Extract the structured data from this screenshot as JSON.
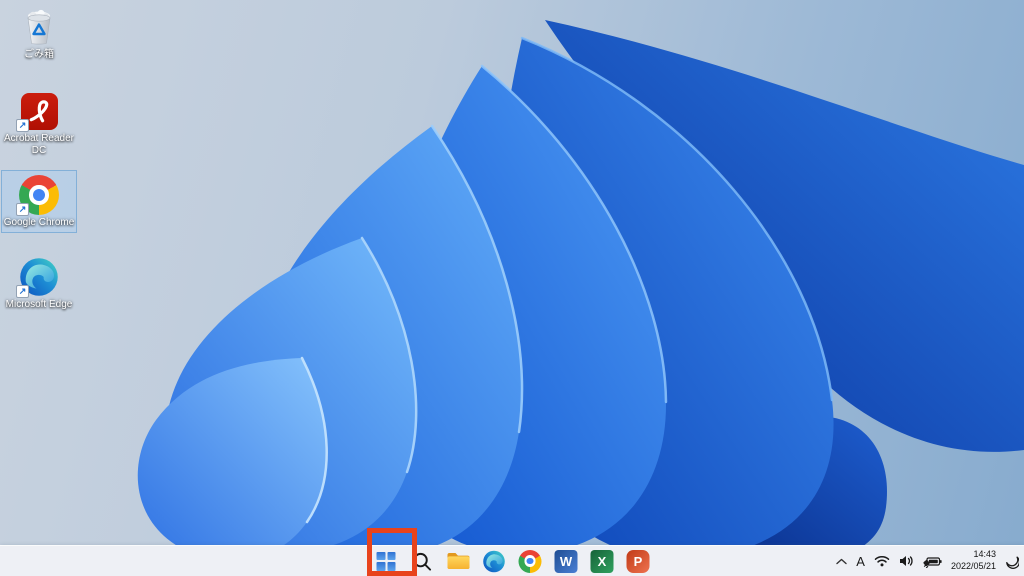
{
  "wallpaper": {
    "name": "windows-11-bloom",
    "background_light": "#C9D3DF",
    "background_deep": "#87ABCE",
    "bloom_dark": "#07309A",
    "bloom_light": "#86C3FC"
  },
  "desktop": {
    "shortcut_glyph": "↗",
    "icons": [
      {
        "id": "recycle-bin",
        "label": "ごみ箱",
        "selected": false,
        "shortcut": false
      },
      {
        "id": "acrobat-reader",
        "label": "Acrobat Reader DC",
        "selected": false,
        "shortcut": true
      },
      {
        "id": "google-chrome",
        "label": "Google Chrome",
        "selected": true,
        "shortcut": true
      },
      {
        "id": "microsoft-edge",
        "label": "Microsoft Edge",
        "selected": false,
        "shortcut": true
      }
    ]
  },
  "taskbar": {
    "background_color": "#EEF0F5",
    "buttons": [
      {
        "id": "start"
      },
      {
        "id": "search"
      },
      {
        "id": "file-explorer"
      },
      {
        "id": "edge"
      },
      {
        "id": "chrome"
      },
      {
        "id": "word",
        "letter": "W"
      },
      {
        "id": "excel",
        "letter": "X"
      },
      {
        "id": "powerpoint",
        "letter": "P"
      }
    ],
    "highlight": {
      "target": "start",
      "color": "#E8431C",
      "style": "red-rectangle"
    },
    "tray": {
      "ime_mode": "A",
      "icons": [
        "chevron-up",
        "ime",
        "wifi",
        "volume",
        "battery-charging",
        "focus-assist-moon"
      ],
      "time": "14:43",
      "date": "2022/05/21"
    }
  }
}
